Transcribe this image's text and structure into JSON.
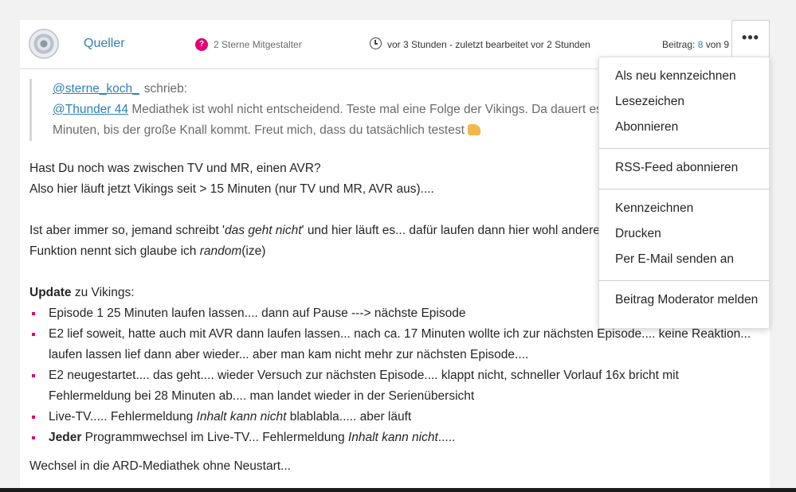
{
  "post": {
    "author": "Queller",
    "rank": "2 Sterne Mitgestalter",
    "time": "vor 3 Stunden - zuletzt bearbeitet vor 2 Stunden",
    "count_prefix": "Beitrag:",
    "count_num": "8",
    "count_suffix": "von 9",
    "menu_label": "•••"
  },
  "quote": {
    "author": "@sterne_koch_",
    "by": "schrieb:",
    "mention": "@Thunder 44",
    "text": "Mediathek ist wohl nicht entscheidend. Teste mal eine Folge der Vikings. Da dauert es Minuten, bis der große Knall kommt. Freut mich, dass du tatsächlich testest"
  },
  "body": {
    "p1_line1": "Hast Du noch was zwischen TV und MR, einen AVR?",
    "p1_line2": "Also hier läuft jetzt Vikings seit > 15 Minuten (nur TV und MR, AVR aus)....",
    "p2_a": "Ist aber immer so, jemand schreibt '",
    "p2_em": "das geht nicht",
    "p2_b": "' und hier läuft es... dafür laufen dann hier wohl andere",
    "p2_c": "Funktion nennt sich glaube ich ",
    "p2_em2": "random",
    "p2_d": "(ize)",
    "update_bold": "Update",
    "update_rest": " zu Vikings:",
    "items": [
      "Episode 1 25 Minuten laufen lassen.... dann auf Pause ---> nächste Episode",
      "E2 lief soweit, hatte auch mit AVR dann laufen lassen... nach ca. 17 Minuten wollte ich zur nächsten Episode.... keine Reaktion... laufen lassen lief dann aber wieder... aber man kam nicht mehr zur nächsten Episode....",
      "E2 neugestartet.... das geht.... wieder Versuch zur nächsten Episode.... klappt nicht, schneller Vorlauf 16x bricht mit Fehlermeldung bei 28 Minuten ab.... man landet wieder in der Serienübersicht"
    ],
    "item4_a": "Live-TV..... Fehlermeldung ",
    "item4_em": "Inhalt kann nicht",
    "item4_b": " blablabla..... aber läuft",
    "item5_bold": "Jeder",
    "item5_a": " Programmwechsel im Live-TV... Fehlermeldung ",
    "item5_em": "Inhalt kann nicht",
    "item5_b": ".....",
    "last_line": "Wechsel in die ARD-Mediathek ohne Neustart..."
  },
  "menu": {
    "group1": [
      "Als neu kennzeichnen",
      "Lesezeichen",
      "Abonnieren"
    ],
    "group2": [
      "RSS-Feed abonnieren"
    ],
    "group3": [
      "Kennzeichnen",
      "Drucken",
      "Per E-Mail senden an"
    ],
    "group4": [
      "Beitrag Moderator melden"
    ]
  },
  "colors": {
    "accent": "#e20074",
    "link": "#2f80b5"
  }
}
